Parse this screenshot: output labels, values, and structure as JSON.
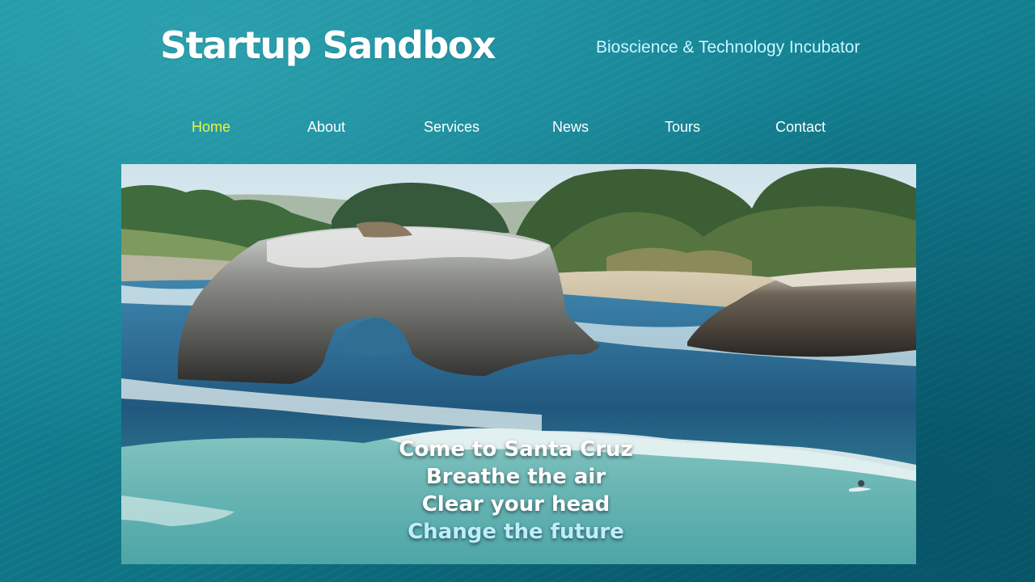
{
  "site": {
    "title": "Startup Sandbox",
    "tagline": "Bioscience & Technology Incubator"
  },
  "nav": {
    "items": [
      {
        "label": "Home",
        "active": true
      },
      {
        "label": "About",
        "active": false
      },
      {
        "label": "Services",
        "active": false
      },
      {
        "label": "News",
        "active": false
      },
      {
        "label": "Tours",
        "active": false
      },
      {
        "label": "Contact",
        "active": false
      }
    ]
  },
  "hero": {
    "lines": [
      "Come to Santa Cruz",
      "Breathe the air",
      "Clear your head",
      "Change the future"
    ]
  },
  "colors": {
    "background": "#127f90",
    "nav_active": "#e8f542",
    "tagline": "#c9f7ff",
    "nav_text": "#ffffff"
  }
}
